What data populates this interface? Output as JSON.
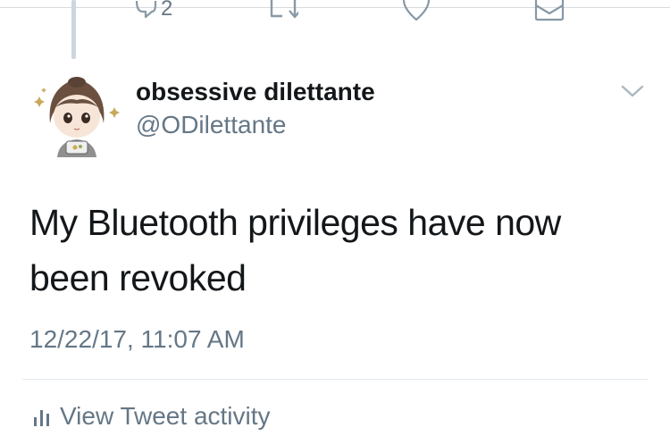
{
  "actions": {
    "reply_count": "2"
  },
  "author": {
    "display_name": "obsessive dilettante",
    "handle": "@ODilettante"
  },
  "tweet": {
    "text": "My Bluetooth privileges have now been revoked",
    "timestamp": "12/22/17, 11:07 AM"
  },
  "footer": {
    "activity_label": "View Tweet activity"
  },
  "colors": {
    "text": "#14171a",
    "secondary": "#657786",
    "divider": "#e1e8ed",
    "thread_line": "#ccd6dd"
  },
  "icons": [
    "reply-icon",
    "retweet-icon",
    "like-icon",
    "direct-message-icon",
    "caret-down-icon",
    "activity-bars-icon"
  ]
}
